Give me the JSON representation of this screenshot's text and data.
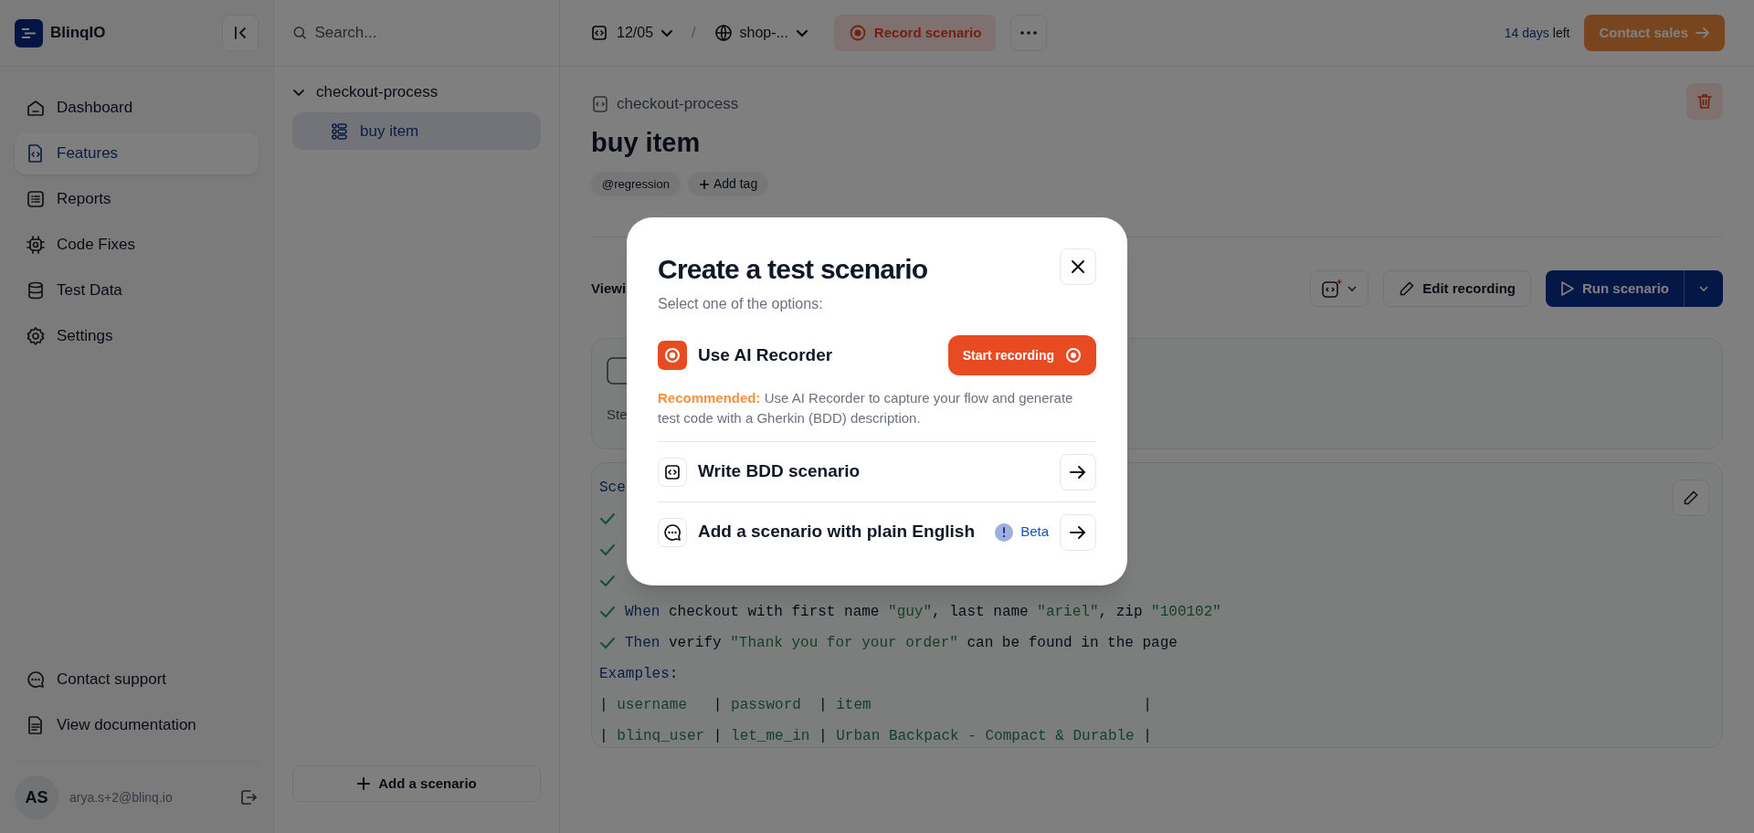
{
  "brand": {
    "name": "BlinqIO"
  },
  "sidebar": {
    "items": [
      {
        "label": "Dashboard",
        "selected": false
      },
      {
        "label": "Features",
        "selected": true
      },
      {
        "label": "Reports",
        "selected": false
      },
      {
        "label": "Code Fixes",
        "selected": false
      },
      {
        "label": "Test Data",
        "selected": false
      },
      {
        "label": "Settings",
        "selected": false
      }
    ],
    "footer_links": [
      {
        "label": "Contact support"
      },
      {
        "label": "View documentation"
      }
    ],
    "user": {
      "initials": "AS",
      "email": "arya.s+2@blinq.io"
    }
  },
  "search": {
    "placeholder": "Search..."
  },
  "feature_tree": {
    "items": [
      {
        "label": "checkout-process",
        "expanded": true,
        "children": [
          {
            "label": "buy item",
            "selected": true
          }
        ]
      }
    ],
    "add_scenario": "Add a scenario"
  },
  "topbar": {
    "version": "12/05",
    "separator": "/",
    "environment": "shop-...",
    "record_button": "Record scenario",
    "trial": {
      "days": "14 days",
      "suffix": "left"
    },
    "contact_sales": "Contact sales"
  },
  "feature": {
    "breadcrumb": "checkout-process",
    "title": "buy item",
    "tags": [
      "@regression"
    ],
    "add_tag": "Add tag",
    "viewing_label": "Viewi",
    "edit_recording": "Edit recording",
    "run_scenario": "Run scenario"
  },
  "steps": {
    "label": "Ste"
  },
  "scenario": {
    "label": "Sce",
    "lines": [
      {
        "passed": true
      },
      {
        "passed": true
      },
      {
        "passed": true
      },
      {
        "passed": true,
        "tokens": [
          {
            "kind": "keyword",
            "text": "When"
          },
          {
            "kind": "plain",
            "text": " checkout with first name "
          },
          {
            "kind": "string",
            "text": "\"guy\""
          },
          {
            "kind": "plain",
            "text": ", last name "
          },
          {
            "kind": "string",
            "text": "\"ariel\""
          },
          {
            "kind": "plain",
            "text": ", zip "
          },
          {
            "kind": "string",
            "text": "\"100102\""
          }
        ]
      },
      {
        "passed": true,
        "tokens": [
          {
            "kind": "keyword",
            "text": "Then"
          },
          {
            "kind": "plain",
            "text": " verify "
          },
          {
            "kind": "string",
            "text": "\"Thank you for your order\""
          },
          {
            "kind": "plain",
            "text": " can be found in the page"
          }
        ]
      },
      {
        "passed": false,
        "tokens": [
          {
            "kind": "keyword",
            "text": "Examples"
          },
          {
            "kind": "plain",
            "text": ":"
          }
        ]
      },
      {
        "passed": false,
        "tokens": [
          {
            "kind": "plain",
            "text": "| "
          },
          {
            "kind": "string",
            "text": "username  "
          },
          {
            "kind": "plain",
            "text": " | "
          },
          {
            "kind": "string",
            "text": "password "
          },
          {
            "kind": "plain",
            "text": " | "
          },
          {
            "kind": "string",
            "text": "item                              "
          },
          {
            "kind": "plain",
            "text": " |"
          }
        ]
      },
      {
        "passed": false,
        "tokens": [
          {
            "kind": "plain",
            "text": "| "
          },
          {
            "kind": "string",
            "text": "blinq_user"
          },
          {
            "kind": "plain",
            "text": " | "
          },
          {
            "kind": "string",
            "text": "let_me_in"
          },
          {
            "kind": "plain",
            "text": " | "
          },
          {
            "kind": "string",
            "text": "Urban Backpack - Compact & Durable"
          },
          {
            "kind": "plain",
            "text": " |"
          }
        ]
      }
    ]
  },
  "modal": {
    "title": "Create a test scenario",
    "subtitle": "Select one of the options:",
    "recorder": {
      "label": "Use AI Recorder",
      "button": "Start recording",
      "description": "**Recommended:** Use AI Recorder to capture your flow and generate test code with a Gherkin (BDD) description."
    },
    "options": [
      {
        "label": "Write BDD scenario"
      },
      {
        "label": "Add a scenario with plain English",
        "badge": "Beta"
      }
    ]
  }
}
